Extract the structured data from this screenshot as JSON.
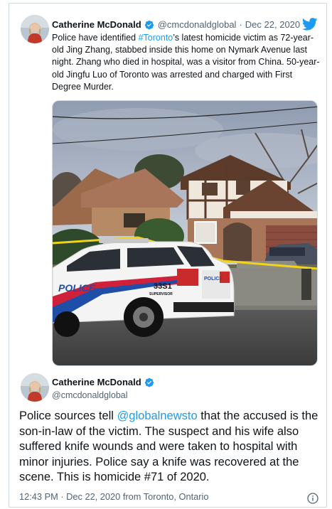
{
  "quoted_tweet": {
    "author_name": "Catherine McDonald",
    "handle": "@cmcdonaldglobal",
    "separator": "·",
    "date": "Dec 22, 2020",
    "text_before": "Police have identified ",
    "hashtag": "#Toronto",
    "text_after": "’s latest homicide victim as 72-year-old Jing Zhang, stabbed inside this home on Nymark Avenue last night. Zhang who died in hospital, was a visitor from China. 50-year-old Jingfu Luo of Toronto was arrested and charged with First Degree Murder.",
    "photo": {
      "car_unit": "33S1",
      "car_unit_sub": "SUPERVISOR",
      "car_side_text": "POLICE",
      "car_rear_text": "POLICE"
    }
  },
  "main_tweet": {
    "author_name": "Catherine McDonald",
    "handle": "@cmcdonaldglobal",
    "text_before": "Police sources tell ",
    "mention": "@globalnewsto",
    "text_after": " that the accused is the son-in-law of the victim. The suspect and his wife also suffered knife wounds and were taken to hospital with minor injuries. Police say a knife was recovered at the scene. This is homicide #71 of 2020.",
    "timestamp": "12:43 PM · Dec 22, 2020 from Toronto, Ontario"
  },
  "icons": {
    "verified": "verified-badge-icon",
    "twitter": "twitter-bird-icon",
    "info": "info-icon"
  },
  "colors": {
    "link": "#1d9bf0",
    "secondary_text": "#536471",
    "border": "#cfd9de",
    "police_red": "#d0213a",
    "police_blue": "#1f4ea8"
  }
}
